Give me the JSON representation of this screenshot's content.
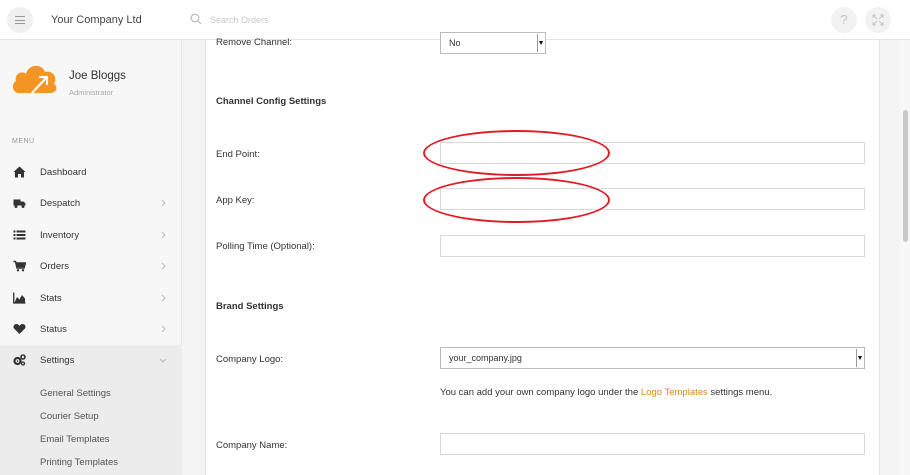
{
  "header": {
    "company": "Your Company Ltd",
    "search_placeholder": "Search Orders",
    "help_glyph": "?",
    "icons": {
      "menu": "hamburger-icon",
      "search": "search-icon",
      "help": "help-icon",
      "fullscreen": "fullscreen-icon"
    }
  },
  "user": {
    "name": "Joe Bloggs",
    "role": "Administrator",
    "logo": "cloud-logo-icon"
  },
  "sidebar": {
    "menu_label": "MENU",
    "items": [
      {
        "label": "Dashboard",
        "icon": "home-icon"
      },
      {
        "label": "Despatch",
        "icon": "truck-icon"
      },
      {
        "label": "Inventory",
        "icon": "list-icon"
      },
      {
        "label": "Orders",
        "icon": "cart-icon"
      },
      {
        "label": "Stats",
        "icon": "area-chart-icon"
      },
      {
        "label": "Status",
        "icon": "heart-icon"
      },
      {
        "label": "Settings",
        "icon": "gears-icon"
      }
    ],
    "settings_sub": [
      "General Settings",
      "Courier Setup",
      "Email Templates",
      "Printing Templates"
    ]
  },
  "form": {
    "remove_channel_label": "Remove Channel:",
    "remove_channel_value": "No",
    "channel_config_title": "Channel Config Settings",
    "end_point_label": "End Point:",
    "end_point_value": "",
    "app_key_label": "App Key:",
    "app_key_value": "",
    "polling_label": "Polling Time (Optional):",
    "polling_value": "",
    "brand_title": "Brand Settings",
    "company_logo_label": "Company Logo:",
    "company_logo_value": "your_company.jpg",
    "logo_help_pre": "You can add your own company logo under the ",
    "logo_help_link": "Logo Templates",
    "logo_help_post": " settings menu.",
    "company_name_label": "Company Name:",
    "company_name_value": ""
  },
  "colors": {
    "annotation": "#e01b24",
    "link": "#d98a1c",
    "logo_orange": "#f39423"
  }
}
